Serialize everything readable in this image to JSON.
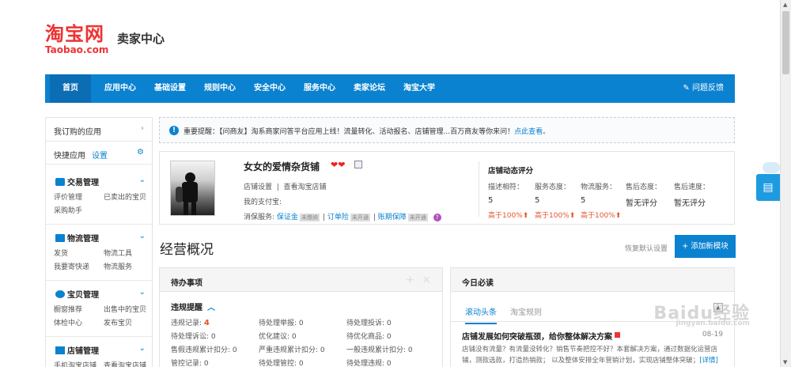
{
  "header": {
    "logo_cn": "淘宝网",
    "logo_en": "Taobao.com",
    "title": "卖家中心"
  },
  "nav": {
    "items": [
      "首页",
      "应用中心",
      "基础设置",
      "规则中心",
      "安全中心",
      "服务中心",
      "卖家论坛",
      "淘宝大学"
    ],
    "feedback": "问题反馈"
  },
  "sidebar": {
    "my_apps": "我订购的应用",
    "quick_apps": "快捷应用",
    "settings": "设置",
    "sections": [
      {
        "title": "交易管理",
        "links": [
          "评价管理",
          "已卖出的宝贝",
          "采购助手"
        ]
      },
      {
        "title": "物流管理",
        "links": [
          "发货",
          "物流工具",
          "我要寄快递",
          "物流服务"
        ]
      },
      {
        "title": "宝贝管理",
        "links": [
          "橱窗推荐",
          "出售中的宝贝",
          "体检中心",
          "发布宝贝"
        ]
      },
      {
        "title": "店铺管理",
        "links": [
          "手机淘宝店铺",
          "查看淘宝店铺"
        ]
      }
    ]
  },
  "notice": {
    "text": "重要提醒：【问商友】淘系商家问答平台应用上线！流量转化、活动报名、店铺管理...百万商友等你来问！",
    "link": "点此查看。"
  },
  "shop": {
    "name": "女女的爱情杂货铺",
    "hearts": "❤❤",
    "settings_link": "店铺设置",
    "view_link": "查看淘宝店铺",
    "alipay_label": "我的支付宝:",
    "guarantee_label": "消保服务:",
    "guarantees": [
      {
        "name": "保证金",
        "tag": "未缴纳"
      },
      {
        "name": "订单险",
        "tag": "未开通"
      },
      {
        "name": "账期保障",
        "tag": "未开通"
      }
    ],
    "help": "?",
    "rating_title": "店铺动态评分",
    "ratings": [
      {
        "label": "描述相符：",
        "value": "5",
        "compare": "高于100%"
      },
      {
        "label": "服务态度：",
        "value": "5",
        "compare": "高于100%"
      },
      {
        "label": "物流服务：",
        "value": "5",
        "compare": "高于100%"
      },
      {
        "label": "售后态度：",
        "value": "暂无评分",
        "compare": ""
      },
      {
        "label": "售后速度：",
        "value": "暂无评分",
        "compare": ""
      }
    ]
  },
  "overview": {
    "title": "经营概况",
    "restore": "恢复默认设置",
    "add_module": "+ 添加新模块"
  },
  "todo": {
    "title": "待办事项",
    "section": "违规提醒",
    "items": [
      {
        "label": "违规记录:",
        "value": "4"
      },
      {
        "label": "待处理举报:",
        "value": "0"
      },
      {
        "label": "待处理投诉:",
        "value": "0"
      },
      {
        "label": "待处理诉讼:",
        "value": "0"
      },
      {
        "label": "优化建议:",
        "value": "0"
      },
      {
        "label": "待优化商品:",
        "value": "0"
      },
      {
        "label": "售假违规累计扣分:",
        "value": "0"
      },
      {
        "label": "严重违规累计扣分:",
        "value": "0"
      },
      {
        "label": "一般违规累计扣分:",
        "value": "0"
      },
      {
        "label": "管控记录:",
        "value": "0"
      },
      {
        "label": "待处理管控:",
        "value": "0"
      },
      {
        "label": "待处理违规:",
        "value": "0"
      }
    ]
  },
  "today": {
    "title": "今日必读",
    "tab_active": "滚动头条",
    "tab_other": "淘宝规则",
    "article_title": "店铺发展如何突破瓶颈，给你整体解决方案",
    "article_date": "08-19",
    "article_desc": "店铺没有流量？有流量没转化？销售节奏把控不好？本套解决方案，通过数据化运营店铺，测款选款，打造热销款； 以及整体安排全年营销计划，实现店铺整体突破；",
    "article_more": "[详情]"
  },
  "watermark": {
    "text": "Baidu经验",
    "sub": "jingyan.baidu.com"
  },
  "colors": {
    "brand_blue": "#0b82d0",
    "taobao_red": "#e33",
    "warn_orange": "#e4542c"
  }
}
